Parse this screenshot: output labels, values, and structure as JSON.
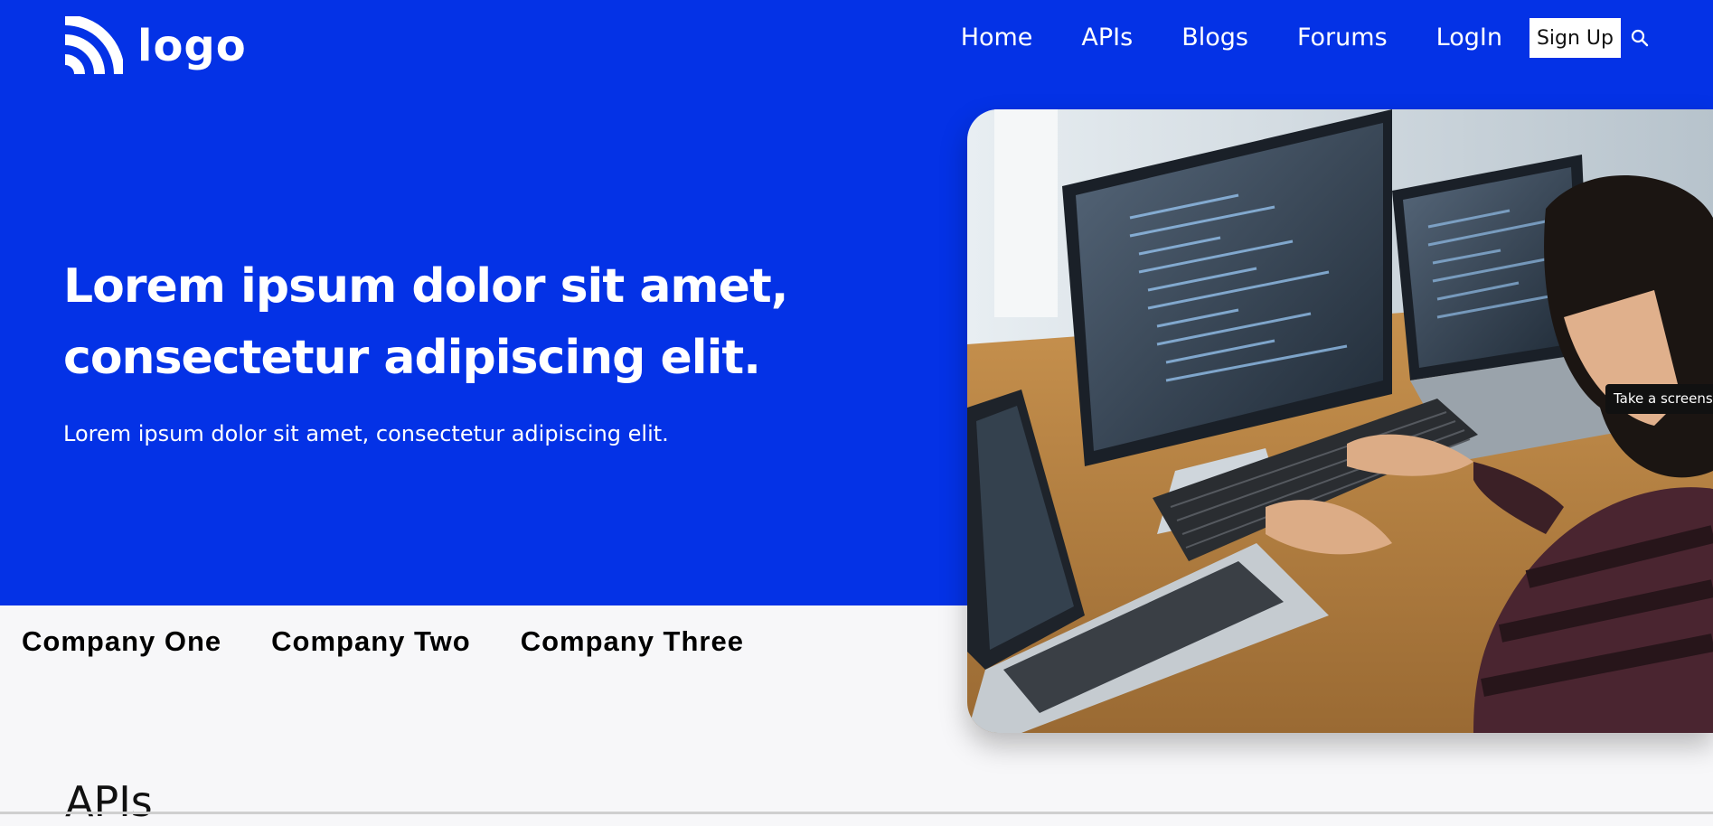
{
  "brand": {
    "logo_text": "logo",
    "icon": "logo-arcs-icon",
    "hero_color": "#0432e6"
  },
  "nav": {
    "items": [
      "Home",
      "APIs",
      "Blogs",
      "Forums",
      "LogIn"
    ],
    "signup_label": "Sign Up",
    "search_icon": "search-icon"
  },
  "hero": {
    "headline_line1": "Lorem ipsum dolor sit amet,",
    "headline_line2": "consectetur adipiscing elit.",
    "subheading": "Lorem ipsum dolor sit amet, consectetur adipiscing elit."
  },
  "tooltip": {
    "text": "Take a screenshot"
  },
  "companies": [
    "Company One",
    "Company Two",
    "Company Three"
  ],
  "section": {
    "title": "APIs"
  }
}
